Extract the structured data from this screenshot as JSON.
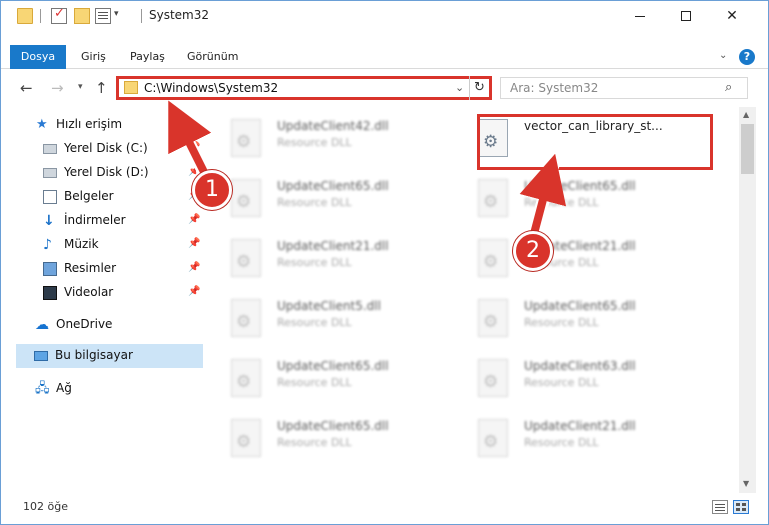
{
  "window": {
    "title": "System32"
  },
  "ribbon": {
    "tabs": [
      "Dosya",
      "Giriş",
      "Paylaş",
      "Görünüm"
    ],
    "help_label": "?"
  },
  "navigation": {
    "address_path": "C:\\Windows\\System32",
    "search_placeholder": "Ara: System32"
  },
  "sidebar": {
    "items": [
      {
        "label": "Hızlı erişim",
        "icon": "star-icon"
      },
      {
        "label": "Yerel Disk (C:)",
        "icon": "drive-icon",
        "pinned": true
      },
      {
        "label": "Yerel Disk (D:)",
        "icon": "drive-icon",
        "pinned": true
      },
      {
        "label": "Belgeler",
        "icon": "documents-icon",
        "pinned": true
      },
      {
        "label": "İndirmeler",
        "icon": "downloads-icon",
        "pinned": true
      },
      {
        "label": "Müzik",
        "icon": "music-icon",
        "pinned": true
      },
      {
        "label": "Resimler",
        "icon": "pictures-icon",
        "pinned": true
      },
      {
        "label": "Videolar",
        "icon": "videos-icon",
        "pinned": true
      },
      {
        "label": "OneDrive",
        "icon": "onedrive-icon"
      },
      {
        "label": "Bu bilgisayar",
        "icon": "this-pc-icon",
        "selected": true
      },
      {
        "label": "Ağ",
        "icon": "network-icon"
      }
    ]
  },
  "files": {
    "left_column": [
      {
        "name": "UpdateClient42.dll",
        "type": "Resource DLL"
      },
      {
        "name": "UpdateClient65.dll",
        "type": "Resource DLL"
      },
      {
        "name": "UpdateClient21.dll",
        "type": "Resource DLL"
      },
      {
        "name": "UpdateClient5.dll",
        "type": "Resource DLL"
      },
      {
        "name": "UpdateClient65.dll",
        "type": "Resource DLL"
      },
      {
        "name": "UpdateClient65.dll",
        "type": "Resource DLL"
      }
    ],
    "right_column": [
      {
        "name": "vector_can_library_st...",
        "type": "",
        "highlighted": true
      },
      {
        "name": "UpdateClient65.dll",
        "type": "Resource DLL"
      },
      {
        "name": "UpdateClient21.dll",
        "type": "Resource DLL"
      },
      {
        "name": "UpdateClient65.dll",
        "type": "Resource DLL"
      },
      {
        "name": "UpdateClient63.dll",
        "type": "Resource DLL"
      },
      {
        "name": "UpdateClient21.dll",
        "type": "Resource DLL"
      }
    ]
  },
  "status": {
    "item_count": "102 öğe"
  },
  "annotations": {
    "step1": "1",
    "step2": "2",
    "color": "#d9342b"
  },
  "colors": {
    "accent": "#1979ca",
    "selection": "#cce4f7"
  }
}
